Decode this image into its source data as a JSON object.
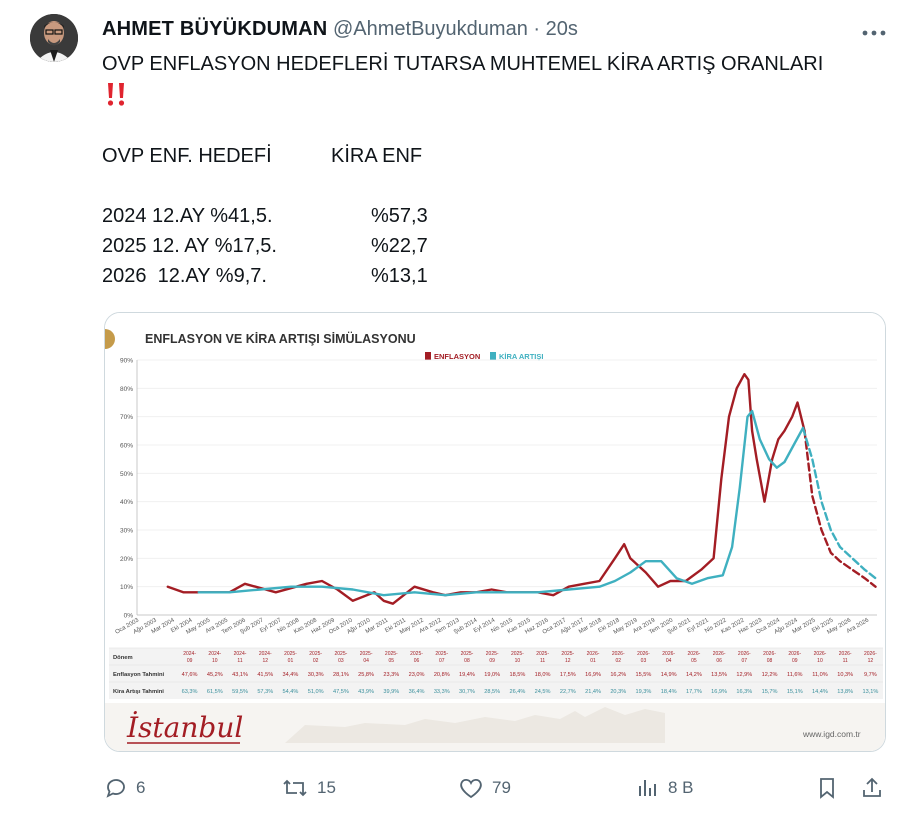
{
  "tweet": {
    "author_name": "AHMET BÜYÜKDUMAN",
    "handle": "@AhmetBuyukduman",
    "separator": "·",
    "time": "20s",
    "text_line1": "OVP ENFLASYON HEDEFLERİ TUTARSA MUHTEMEL KİRA ARTIŞ ORANLARI",
    "emoji": "‼️",
    "col_header_left": "OVP ENF. HEDEFİ",
    "col_header_right": "KİRA ENF",
    "rows": [
      {
        "left": "2024 12.AY %41,5.",
        "right": "%57,3"
      },
      {
        "left": "2025 12. AY %17,5.",
        "right": "%22,7"
      },
      {
        "left": "2026  12.AY %9,7.",
        "right": "%13,1"
      }
    ]
  },
  "chart_card": {
    "title": "ENFLASYON VE KİRA ARTIŞI SİMÜLASYONU",
    "legend": [
      {
        "label": "ENFLASYON",
        "color": "#a31d24"
      },
      {
        "label": "KİRA ARTIŞI",
        "color": "#3fb0c0"
      }
    ],
    "footer_logo": "İstanbul",
    "footer_url": "www.igd.com.tr"
  },
  "chart_data": {
    "type": "line",
    "title": "ENFLASYON VE KİRA ARTIŞI SİMÜLASYONU",
    "ylim": [
      0,
      90
    ],
    "yticks": [
      "0%",
      "10%",
      "20%",
      "30%",
      "40%",
      "50%",
      "60%",
      "70%",
      "80%",
      "90%"
    ],
    "xtick_labels": [
      "Oca 2003",
      "Ağu 2003",
      "Mar 2004",
      "Eki 2004",
      "May 2005",
      "Ara 2005",
      "Tem 2006",
      "Şub 2007",
      "Eyl 2007",
      "Nis 2008",
      "Kas 2008",
      "Haz 2009",
      "Oca 2010",
      "Ağu 2010",
      "Mar 2011",
      "Eki 2011",
      "May 2012",
      "Ara 2012",
      "Tem 2013",
      "Şub 2014",
      "Eyl 2014",
      "Nis 2015",
      "Kas 2015",
      "Haz 2016",
      "Oca 2017",
      "Ağu 2017",
      "Mar 2018",
      "Eki 2018",
      "May 2019",
      "Ara 2019",
      "Tem 2020",
      "Şub 2021",
      "Eyl 2021",
      "Nis 2022",
      "Kas 2022",
      "Haz 2023",
      "Oca 2024",
      "Ağu 2024",
      "Mar 2025",
      "Eki 2025",
      "May 2026",
      "Ara 2026"
    ],
    "series": [
      {
        "name": "ENFLASYON",
        "color": "#a31d24",
        "x": [
          2004.0,
          2004.5,
          2005.0,
          2006.0,
          2006.5,
          2007.5,
          2008.5,
          2009.0,
          2009.5,
          2010.0,
          2010.7,
          2011.0,
          2011.3,
          2012.0,
          2012.6,
          2013.0,
          2013.5,
          2014.0,
          2014.5,
          2015.0,
          2016.0,
          2016.5,
          2017.0,
          2017.5,
          2018.0,
          2018.5,
          2018.8,
          2019.0,
          2019.5,
          2019.9,
          2020.3,
          2020.8,
          2021.3,
          2021.7,
          2021.95,
          2022.2,
          2022.45,
          2022.7,
          2022.83,
          2022.95,
          2023.1,
          2023.35,
          2023.6,
          2023.8,
          2024.0,
          2024.25,
          2024.42,
          2024.65
        ],
        "y": [
          10,
          8,
          8,
          8,
          11,
          8,
          11,
          12,
          9,
          5,
          8,
          5,
          4,
          10,
          8,
          7,
          8,
          8,
          9,
          8,
          8,
          7,
          10,
          11,
          12,
          20,
          25,
          20,
          15,
          10,
          12,
          12,
          16,
          20,
          48,
          70,
          80,
          85,
          83,
          65,
          55,
          40,
          55,
          62,
          65,
          70,
          75,
          65
        ]
      },
      {
        "name": "ENFLASYON (tahmin)",
        "color": "#a31d24",
        "dashed": true,
        "x": [
          2024.65,
          2024.9,
          2025.2,
          2025.5,
          2025.8,
          2026.2,
          2026.6,
          2026.95
        ],
        "y": [
          65,
          42,
          30,
          22,
          19,
          16,
          13,
          10
        ]
      },
      {
        "name": "KİRA ARTIŞI",
        "color": "#3fb0c0",
        "x": [
          2005.0,
          2006.0,
          2007.0,
          2008.0,
          2009.0,
          2010.0,
          2011.0,
          2012.0,
          2013.0,
          2014.0,
          2015.0,
          2016.0,
          2017.0,
          2018.0,
          2018.5,
          2019.0,
          2019.5,
          2020.0,
          2020.5,
          2021.0,
          2021.5,
          2022.0,
          2022.3,
          2022.55,
          2022.8,
          2022.95,
          2023.2,
          2023.5,
          2023.75,
          2024.0,
          2024.3,
          2024.6
        ],
        "y": [
          8,
          8,
          9,
          10,
          10,
          9,
          7,
          8,
          7,
          8,
          8,
          8,
          9,
          10,
          12,
          15,
          19,
          19,
          13,
          11,
          13,
          14,
          24,
          45,
          70,
          72,
          62,
          55,
          52,
          54,
          60,
          66
        ]
      },
      {
        "name": "KİRA ARTIŞI (tahmin)",
        "color": "#3fb0c0",
        "dashed": true,
        "x": [
          2024.6,
          2024.9,
          2025.2,
          2025.5,
          2025.8,
          2026.2,
          2026.6,
          2026.95
        ],
        "y": [
          66,
          55,
          40,
          30,
          24,
          20,
          16,
          13
        ]
      }
    ],
    "table": {
      "row_labels": [
        "Dönem",
        "Enflasyon Tahmini",
        "Kira Artışı Tahmini"
      ],
      "periods": [
        "2024-09",
        "2024-10",
        "2024-11",
        "2024-12",
        "2025-01",
        "2025-02",
        "2025-03",
        "2025-04",
        "2025-05",
        "2025-06",
        "2025-07",
        "2025-08",
        "2025-09",
        "2025-10",
        "2025-11",
        "2025-12",
        "2026-01",
        "2026-02",
        "2026-03",
        "2026-04",
        "2026-05",
        "2026-06",
        "2026-07",
        "2026-08",
        "2026-09",
        "2026-10",
        "2026-11",
        "2026-12"
      ],
      "inflation": [
        "47,6%",
        "45,2%",
        "43,1%",
        "41,5%",
        "34,4%",
        "30,3%",
        "28,1%",
        "25,8%",
        "23,3%",
        "23,0%",
        "20,8%",
        "19,4%",
        "19,0%",
        "18,5%",
        "18,0%",
        "17,5%",
        "16,9%",
        "16,2%",
        "15,5%",
        "14,9%",
        "14,2%",
        "13,5%",
        "12,9%",
        "12,2%",
        "11,6%",
        "11,0%",
        "10,3%",
        "9,7%"
      ],
      "rent": [
        "63,3%",
        "61,5%",
        "59,5%",
        "57,3%",
        "54,4%",
        "51,0%",
        "47,5%",
        "43,9%",
        "39,9%",
        "36,4%",
        "33,3%",
        "30,7%",
        "28,5%",
        "26,4%",
        "24,5%",
        "22,7%",
        "21,4%",
        "20,3%",
        "19,3%",
        "18,4%",
        "17,7%",
        "16,9%",
        "16,3%",
        "15,7%",
        "15,1%",
        "14,4%",
        "13,8%",
        "13,1%"
      ]
    }
  },
  "actions": {
    "reply_count": "6",
    "retweet_count": "15",
    "like_count": "79",
    "views_count": "8 B"
  }
}
